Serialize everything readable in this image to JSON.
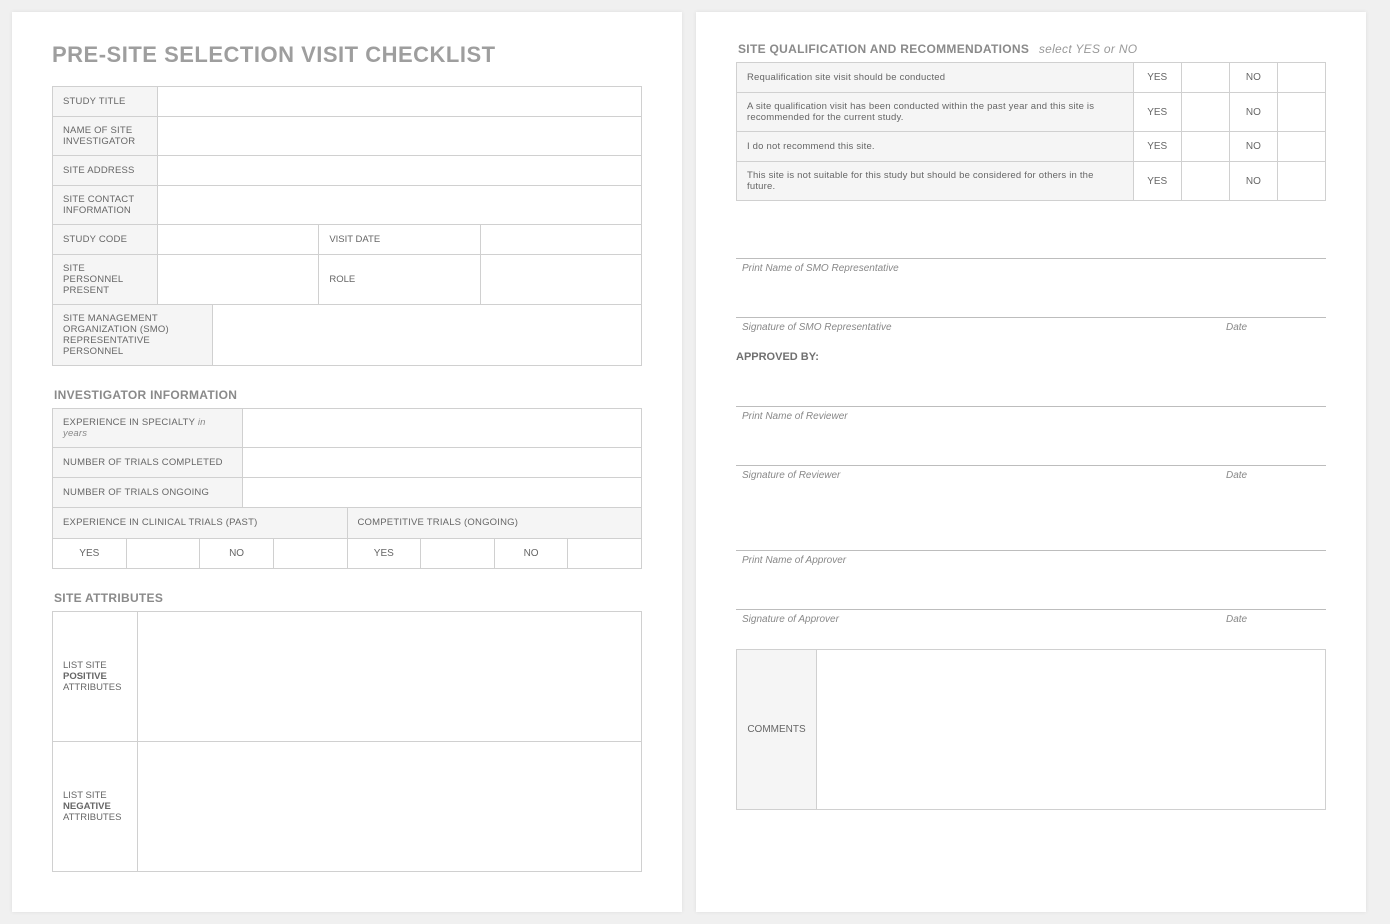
{
  "title": "PRE-SITE SELECTION VISIT CHECKLIST",
  "study_info": {
    "study_title": "STUDY TITLE",
    "investigator": "NAME OF SITE INVESTIGATOR",
    "site_address": "SITE ADDRESS",
    "site_contact": "SITE CONTACT INFORMATION",
    "study_code": "STUDY CODE",
    "visit_date": "VISIT DATE",
    "personnel_present": "SITE PERSONNEL PRESENT",
    "role": "ROLE",
    "smo_rep": "SITE MANAGEMENT ORGANIZATION (SMO) REPRESENTATIVE PERSONNEL"
  },
  "investigator_info": {
    "header": "INVESTIGATOR INFORMATION",
    "experience_specialty": "EXPERIENCE IN SPECIALTY",
    "in_years": "in years",
    "trials_completed": "NUMBER OF TRIALS COMPLETED",
    "trials_ongoing": "NUMBER OF TRIALS ONGOING",
    "experience_past": "EXPERIENCE IN CLINICAL TRIALS (PAST)",
    "competitive_ongoing": "COMPETITIVE TRIALS (ONGOING)",
    "yes": "YES",
    "no": "NO"
  },
  "site_attributes": {
    "header": "SITE ATTRIBUTES",
    "positive_pre": "LIST SITE",
    "positive_bold": "POSITIVE",
    "positive_post": "ATTRIBUTES",
    "negative_pre": "LIST SITE",
    "negative_bold": "NEGATIVE",
    "negative_post": "ATTRIBUTES"
  },
  "qualification": {
    "header": "SITE QUALIFICATION AND RECOMMENDATIONS",
    "hint": "select YES or NO",
    "yes": "YES",
    "no": "NO",
    "items": [
      "Requalification site visit should be conducted",
      "A site qualification visit has been conducted within the past year and this site is recommended for the current study.",
      "I do not recommend this site.",
      "This site is not suitable for this study but should be considered for others in the future."
    ]
  },
  "signatures": {
    "smo_print": "Print Name of SMO Representative",
    "smo_sign": "Signature of SMO Representative",
    "date": "Date",
    "approved_by": "APPROVED BY:",
    "rev_print": "Print Name of Reviewer",
    "rev_sign": "Signature of Reviewer",
    "app_print": "Print Name of Approver",
    "app_sign": "Signature of Approver"
  },
  "comments_label": "COMMENTS"
}
